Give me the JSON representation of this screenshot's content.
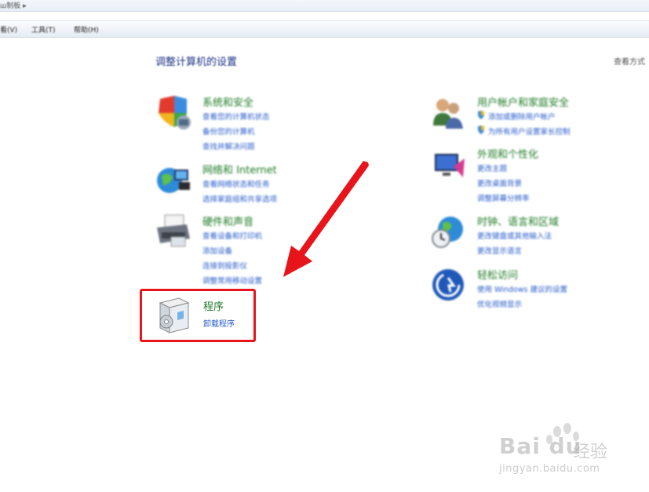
{
  "window": {
    "address_text": "ш制板 ▸"
  },
  "menu": {
    "view": "看(V)",
    "tools": "工具(T)",
    "help": "帮助(H)"
  },
  "page": {
    "title": "调整计算机的设置",
    "view_by": "查看方式"
  },
  "categories_left": [
    {
      "title": "系统和安全",
      "links": [
        "查看您的计算机状态",
        "备份您的计算机",
        "查找并解决问题"
      ]
    },
    {
      "title": "网络和 Internet",
      "links": [
        "查看网络状态和任务",
        "选择家庭组和共享选项"
      ]
    },
    {
      "title": "硬件和声音",
      "links": [
        "查看设备和打印机",
        "添加设备",
        "连接到投影仪",
        "调整常用移动设置"
      ]
    }
  ],
  "programs": {
    "title": "程序",
    "link": "卸载程序"
  },
  "categories_right": [
    {
      "title": "用户帐户和家庭安全",
      "links": [
        "添加或删除用户帐户",
        "为所有用户设置家长控制"
      ]
    },
    {
      "title": "外观和个性化",
      "links": [
        "更改主题",
        "更改桌面背景",
        "调整屏幕分辨率"
      ]
    },
    {
      "title": "时钟、语言和区域",
      "links": [
        "更改键盘或其他输入法",
        "更改显示语言"
      ]
    },
    {
      "title": "轻松访问",
      "links": [
        "使用 Windows 建议的设置",
        "优化视频显示"
      ]
    }
  ],
  "watermark": {
    "brand": "Bai du",
    "cn": "经验",
    "url": "jingyan.baidu.com"
  },
  "colors": {
    "title_green": "#1d7a24",
    "link_blue": "#2358c9",
    "highlight_red": "#e8141c"
  }
}
